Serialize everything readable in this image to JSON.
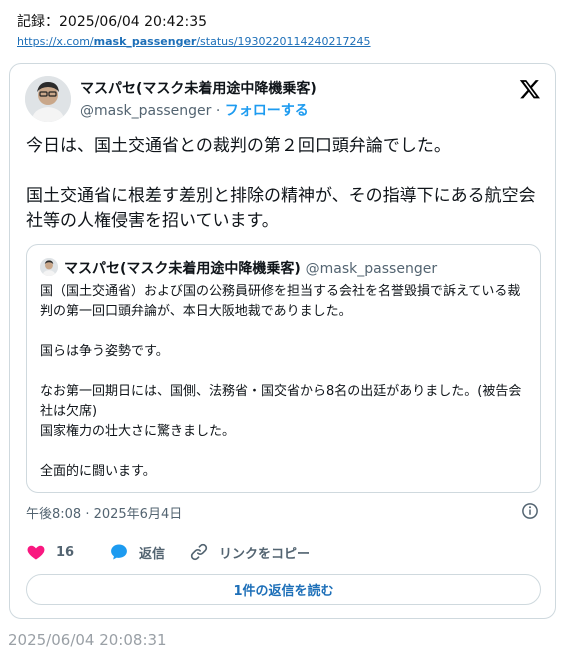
{
  "record": {
    "label": "記録：2025/06/04 20:42:35",
    "url_prefix": "https://x.com/",
    "url_user": "mask_passenger",
    "url_suffix": "/status/1930220114240217245"
  },
  "tweet": {
    "display_name": "マスパセ(マスク未着用途中降機乗客)",
    "handle": "@mask_passenger",
    "separator": " · ",
    "follow_label": "フォローする",
    "paragraphs": [
      "今日は、国土交通省との裁判の第２回口頭弁論でした。",
      "国土交通省に根差す差別と排除の精神が、その指導下にある航空会社等の人権侵害を招いています。"
    ],
    "timestamp": "午後8:08 · 2025年6月4日",
    "like_count": "16",
    "reply_label": "返信",
    "copy_link_label": "リンクをコピー",
    "read_replies_label": "1件の返信を読む"
  },
  "quote": {
    "display_name": "マスパセ(マスク未着用途中降機乗客)",
    "handle": "@mask_passenger",
    "paragraphs": [
      "国（国土交通省）および国の公務員研修を担当する会社を名誉毀損で訴えている裁判の第一回口頭弁論が、本日大阪地裁でありました。",
      "国らは争う姿勢です。",
      "なお第一回期日には、国側、法務省・国交省から8名の出廷がありました。(被告会社は欠席)\n国家権力の壮大さに驚きました。",
      "全面的に闘います。"
    ]
  },
  "footer": {
    "captured_time": "2025/06/04 20:08:31"
  },
  "colors": {
    "accent": "#1d9bf0",
    "like": "#f91880",
    "border": "#cfd9de",
    "muted": "#536471"
  },
  "icons": [
    "x-logo-icon",
    "heart-icon",
    "reply-bubble-icon",
    "link-icon",
    "info-icon"
  ]
}
